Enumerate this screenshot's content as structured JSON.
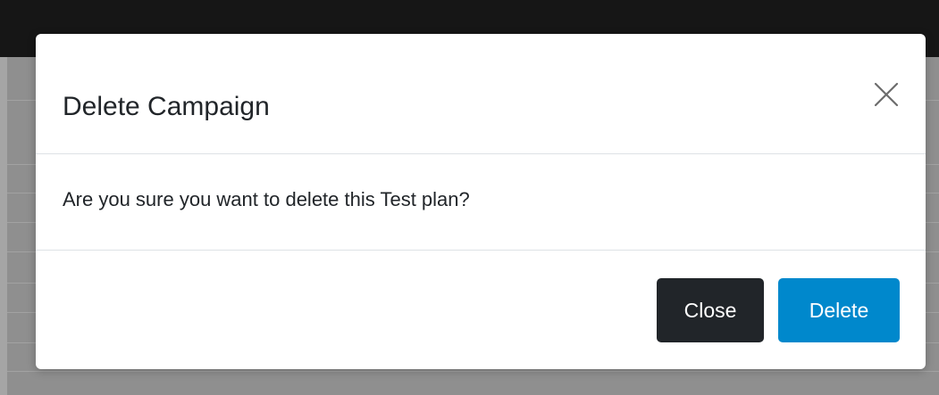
{
  "modal": {
    "title": "Delete Campaign",
    "close_icon": "close-icon",
    "message": "Are you sure you want to delete this Test plan?",
    "buttons": {
      "close_label": "Close",
      "delete_label": "Delete"
    }
  },
  "colors": {
    "close_button": "#212529",
    "delete_button": "#0088cc",
    "backdrop": "#8f8f8f",
    "topbar": "#161616"
  }
}
